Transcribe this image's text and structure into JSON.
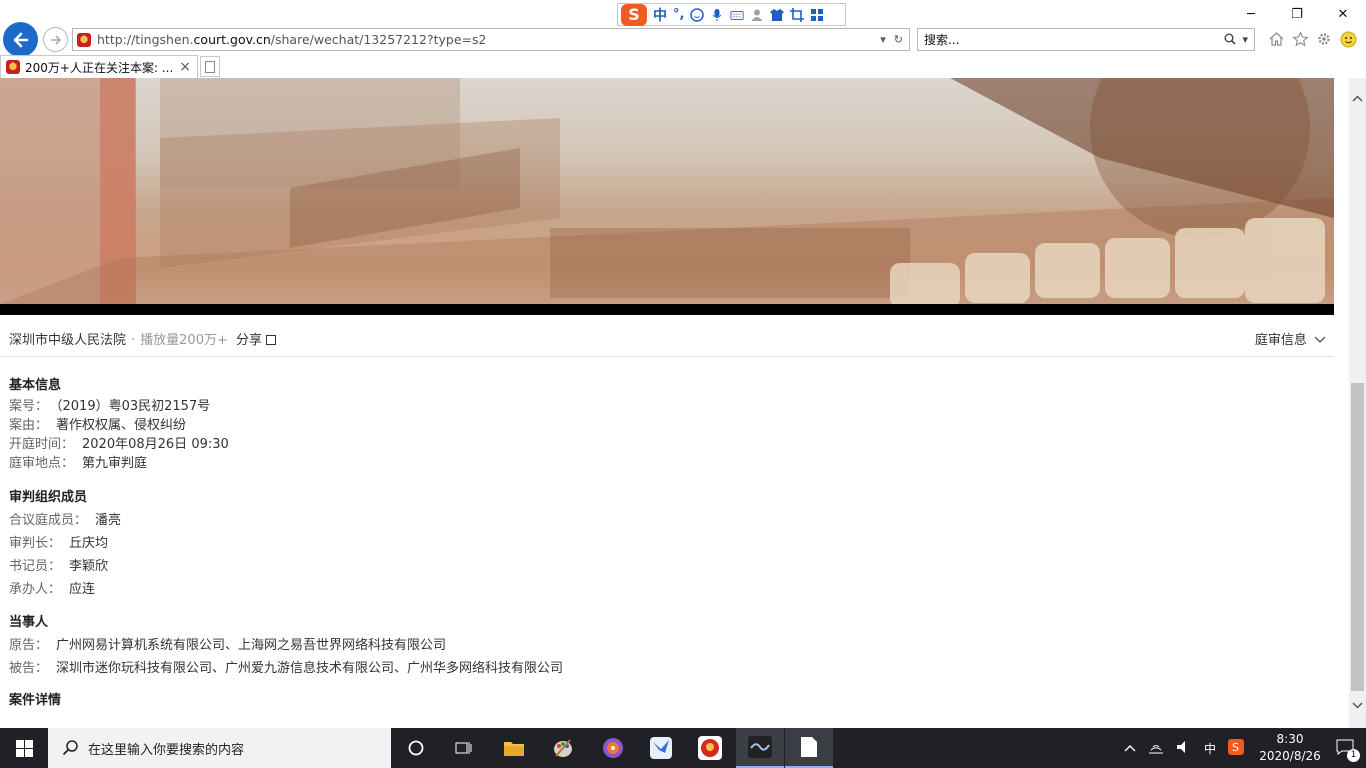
{
  "browser": {
    "url_prefix": "http://tingshen.",
    "url_host": "court.gov.cn",
    "url_path": "/share/wechat/13257212?type=s2",
    "search_placeholder": "搜索...",
    "tab_title": "200万+人正在关注本案: ...",
    "tab_close": "×"
  },
  "ime": {
    "logo": "S",
    "mode": "中",
    "punct": "°,"
  },
  "meta": {
    "court": "深圳市中级人民法院",
    "separator": "·",
    "plays": "播放量200万+",
    "share": "分享",
    "info_toggle": "庭审信息"
  },
  "basic": {
    "title": "基本信息",
    "rows": [
      {
        "k": "案号：",
        "v": "（2019）粤03民初2157号"
      },
      {
        "k": "案由：",
        "v": "著作权权属、侵权纠纷"
      },
      {
        "k": "开庭时间：",
        "v": "2020年08月26日 09:30"
      },
      {
        "k": "庭审地点：",
        "v": "第九审判庭"
      }
    ]
  },
  "panel": {
    "title": "审判组织成员",
    "rows": [
      {
        "k": "合议庭成员：",
        "v": "潘亮"
      },
      {
        "k": "审判长：",
        "v": "丘庆均"
      },
      {
        "k": "书记员：",
        "v": "李颖欣"
      },
      {
        "k": "承办人：",
        "v": "应连"
      }
    ]
  },
  "parties": {
    "title": "当事人",
    "rows": [
      {
        "k": "原告：",
        "v": "广州网易计算机系统有限公司、上海网之易吾世界网络科技有限公司"
      },
      {
        "k": "被告：",
        "v": "深圳市迷你玩科技有限公司、广州爱九游信息技术有限公司、广州华多网络科技有限公司"
      }
    ]
  },
  "details": {
    "title": "案件详情"
  },
  "taskbar": {
    "search_placeholder": "在这里输入你要搜索的内容",
    "ime": "中",
    "time": "8:30",
    "date": "2020/8/26",
    "notifications": "1"
  }
}
